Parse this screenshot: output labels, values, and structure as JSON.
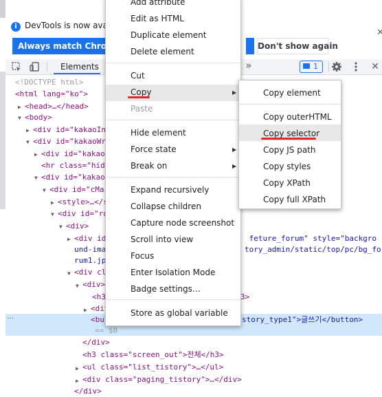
{
  "infobar": {
    "text": "DevTools is now availa",
    "match_button": "Always match Chrome's",
    "dont_show": "Don't show again",
    "close": "✕"
  },
  "toolbar": {
    "elements_tab": "Elements",
    "more": "»",
    "issues_count": "1",
    "close": "✕"
  },
  "dom_lines": [
    "<!DOCTYPE html>",
    "<html lang=\"ko\">",
    "<head>…</head>",
    "<body>",
    "<div id=\"kakaoIn",
    "<div id=\"kakaoWr",
    "<div id=\"kakaoH",
    "<hr class=\"hide",
    "<div id=\"kakaoC",
    "<div id=\"cMain",
    "<style>…</s",
    "<div id=\"ro",
    "<div>",
    "<div id",
    "und-ima",
    "rum1.jp",
    "<div cl",
    "<div>",
    "<h3",
    "<div",
    "<but",
    "== $0",
    "</div>",
    "<h3 class=\"screen_out\">전체</h3>",
    "<ul class=\"list_tistory\">…</ul>",
    "<div class=\"paging_tistory\">…</div>",
    "</div>"
  ],
  "dom_right": {
    "line1": " feture_forum\" style=\"backgro",
    "line2": "tory_admin/static/top/pc/bg_fo",
    "line3": "3>",
    "line4": "story_type1\">글쓰기</button>"
  },
  "context_menu": {
    "items": [
      "Add attribute",
      "Edit as HTML",
      "Duplicate element",
      "Delete element",
      "Cut",
      "Copy",
      "Paste",
      "Hide element",
      "Force state",
      "Break on",
      "Expand recursively",
      "Collapse children",
      "Capture node screenshot",
      "Scroll into view",
      "Focus",
      "Enter Isolation Mode",
      "Badge settings…",
      "Store as global variable"
    ]
  },
  "copy_submenu": {
    "items": [
      "Copy element",
      "Copy outerHTML",
      "Copy selector",
      "Copy JS path",
      "Copy styles",
      "Copy XPath",
      "Copy full XPath"
    ]
  },
  "colors": {
    "accent": "#1a73e8",
    "highlight_underline": "#e3262b",
    "selected_row": "#cfe8fc"
  }
}
